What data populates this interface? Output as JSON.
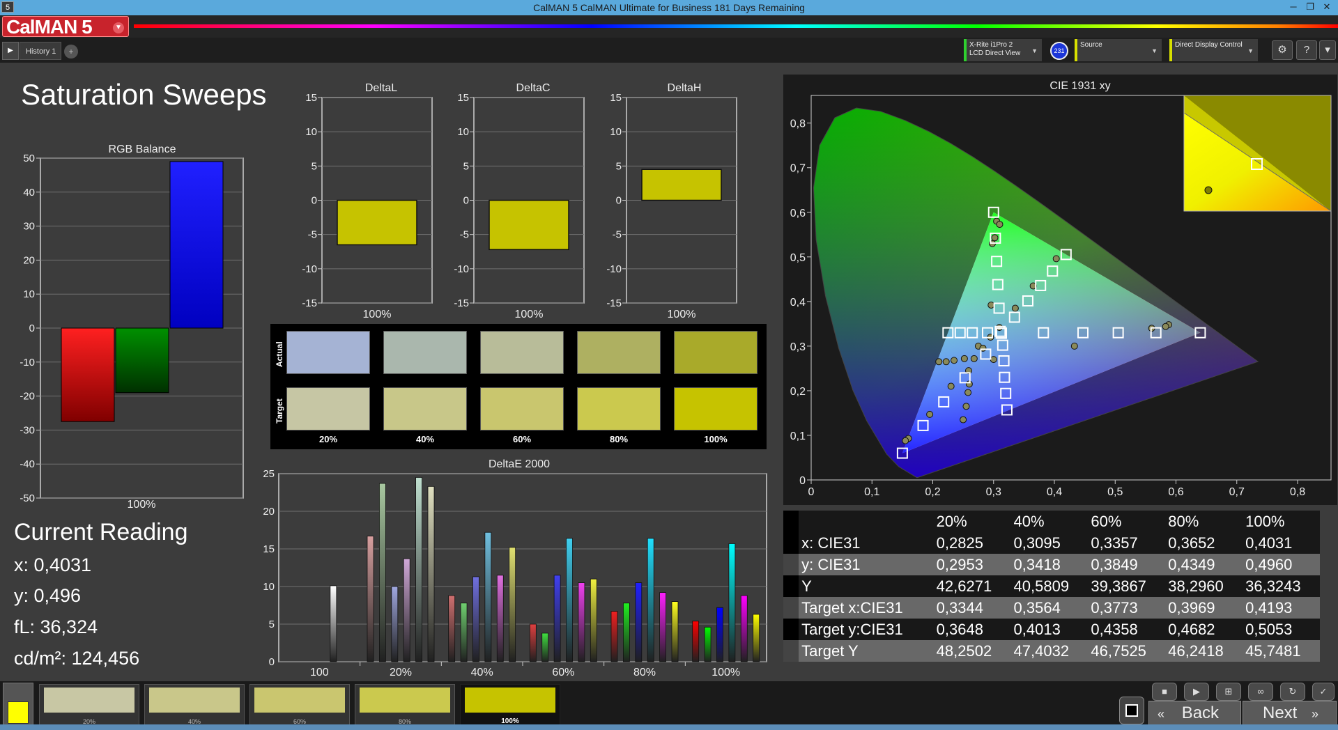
{
  "window": {
    "title": "CalMAN 5 CalMAN Ultimate for Business 181 Days Remaining",
    "app_icon": "5"
  },
  "app": {
    "logo": "CalMAN 5"
  },
  "tabs": [
    {
      "label": "History 1"
    }
  ],
  "devices": {
    "meter_line1": "X-Rite i1Pro 2",
    "meter_line2": "LCD Direct View",
    "meter_badge": "231",
    "source": "Source",
    "display": "Direct Display Control"
  },
  "page": {
    "title": "Saturation Sweeps"
  },
  "rgb_balance": {
    "title": "RGB Balance",
    "yticks": [
      "50",
      "40",
      "30",
      "20",
      "10",
      "0",
      "-10",
      "-20",
      "-30",
      "-40",
      "-50"
    ],
    "xlabel": "100%"
  },
  "delta_charts": [
    {
      "title": "DeltaL",
      "xlabel": "100%"
    },
    {
      "title": "DeltaC",
      "xlabel": "100%"
    },
    {
      "title": "DeltaH",
      "xlabel": "100%"
    }
  ],
  "delta_yticks": [
    "15",
    "10",
    "5",
    "0",
    "-5",
    "-10",
    "-15"
  ],
  "swatches": {
    "row_actual": "Actual",
    "row_target": "Target",
    "labels": [
      "20%",
      "40%",
      "60%",
      "80%",
      "100%"
    ],
    "actual": [
      "#a5b3d4",
      "#aab7ad",
      "#b8bc99",
      "#aeb061",
      "#a9aa2a"
    ],
    "target": [
      "#c6c6a4",
      "#c8c789",
      "#c9c66e",
      "#cbc94e",
      "#c6c300"
    ]
  },
  "deltae": {
    "title": "DeltaE 2000",
    "yticks": [
      "25",
      "20",
      "15",
      "10",
      "5",
      "0"
    ],
    "xlabels": [
      "100",
      "20%",
      "40%",
      "60%",
      "80%",
      "100%"
    ]
  },
  "cie": {
    "title": "CIE 1931 xy",
    "xticks": [
      "0",
      "0,1",
      "0,2",
      "0,3",
      "0,4",
      "0,5",
      "0,6",
      "0,7",
      "0,8"
    ],
    "yticks": [
      "0,8",
      "0,7",
      "0,6",
      "0,5",
      "0,4",
      "0,3",
      "0,2",
      "0,1",
      "0"
    ]
  },
  "current_reading": {
    "title": "Current Reading",
    "x": "x: 0,4031",
    "y": "y: 0,496",
    "fl": "fL: 36,324",
    "cdm": "cd/m²: 124,456"
  },
  "table": {
    "headers": [
      "",
      "20%",
      "40%",
      "60%",
      "80%",
      "100%"
    ],
    "rows": [
      {
        "label": "x: CIE31",
        "values": [
          "0,2825",
          "0,3095",
          "0,3357",
          "0,3652",
          "0,4031"
        ]
      },
      {
        "label": "y: CIE31",
        "values": [
          "0,2953",
          "0,3418",
          "0,3849",
          "0,4349",
          "0,4960"
        ]
      },
      {
        "label": "Y",
        "values": [
          "42,6271",
          "40,5809",
          "39,3867",
          "38,2960",
          "36,3243"
        ]
      },
      {
        "label": "Target x:CIE31",
        "values": [
          "0,3344",
          "0,3564",
          "0,3773",
          "0,3969",
          "0,4193"
        ]
      },
      {
        "label": "Target y:CIE31",
        "values": [
          "0,3648",
          "0,4013",
          "0,4358",
          "0,4682",
          "0,5053"
        ]
      },
      {
        "label": "Target Y",
        "values": [
          "48,2502",
          "47,4032",
          "46,7525",
          "46,2418",
          "45,7481"
        ]
      }
    ]
  },
  "bottom": {
    "swatch_labels": [
      "20%",
      "40%",
      "60%",
      "80%",
      "100%"
    ],
    "swatch_colors": [
      "#c8c7a4",
      "#c9c78a",
      "#cac66f",
      "#cbc94e",
      "#c6c300"
    ],
    "back": "Back",
    "next": "Next"
  },
  "chart_data": [
    {
      "type": "bar",
      "title": "RGB Balance",
      "categories": [
        "100%"
      ],
      "series": [
        {
          "values": [
            -27.5
          ]
        },
        {
          "values": [
            -19
          ]
        },
        {
          "values": [
            49
          ]
        }
      ],
      "ylim": [
        -50,
        50
      ],
      "colors": [
        "#ff0000",
        "#00a000",
        "#0000ff"
      ]
    },
    {
      "type": "bar",
      "title": "DeltaL",
      "categories": [
        "100%"
      ],
      "values": [
        -6.5
      ],
      "ylim": [
        -15,
        15
      ]
    },
    {
      "type": "bar",
      "title": "DeltaC",
      "categories": [
        "100%"
      ],
      "values": [
        -7.2
      ],
      "ylim": [
        -15,
        15
      ]
    },
    {
      "type": "bar",
      "title": "DeltaH",
      "categories": [
        "100%"
      ],
      "values": [
        4.5
      ],
      "ylim": [
        -15,
        15
      ]
    },
    {
      "type": "bar",
      "title": "DeltaE 2000",
      "categories": [
        "100",
        "20%",
        "40%",
        "60%",
        "80%",
        "100%"
      ],
      "ylim": [
        0,
        25
      ],
      "groups": [
        {
          "values": [
            10.1
          ],
          "colors": [
            "#ffffff"
          ]
        },
        {
          "values": [
            16.7,
            23.7,
            10.0,
            13.7,
            24.5,
            23.3
          ],
          "colors": [
            "#d8a0a0",
            "#a8c8a0",
            "#a0a8e0",
            "#d0a8d8",
            "#c0e0d0",
            "#e0e0c0"
          ]
        },
        {
          "values": [
            8.8,
            7.8,
            11.3,
            17.2,
            11.5,
            15.2
          ],
          "colors": [
            "#d07070",
            "#70d070",
            "#7070e0",
            "#70c0e0",
            "#e070e0",
            "#e0e070"
          ]
        },
        {
          "values": [
            5.0,
            3.8,
            11.5,
            16.4,
            10.5,
            11.0
          ],
          "colors": [
            "#e04040",
            "#40e040",
            "#4040f0",
            "#40d0f0",
            "#f040f0",
            "#f0f040"
          ]
        },
        {
          "values": [
            6.7,
            7.8,
            10.5,
            16.4,
            9.2,
            8.0
          ],
          "colors": [
            "#f02020",
            "#20f020",
            "#2020ff",
            "#20e0ff",
            "#ff20ff",
            "#ffff20"
          ]
        },
        {
          "values": [
            5.4,
            4.6,
            7.2,
            15.7,
            8.8,
            6.3
          ],
          "colors": [
            "#ff0000",
            "#00ff00",
            "#0000ff",
            "#00ffff",
            "#ff00ff",
            "#ffff00"
          ]
        }
      ]
    },
    {
      "type": "scatter",
      "title": "CIE 1931 xy",
      "xlim": [
        0,
        0.8
      ],
      "ylim": [
        0,
        0.8
      ],
      "gamut": [
        [
          0.64,
          0.33
        ],
        [
          0.3,
          0.6
        ],
        [
          0.15,
          0.06
        ]
      ],
      "targets": [
        [
          0.15,
          0.06
        ],
        [
          0.184,
          0.122
        ],
        [
          0.218,
          0.175
        ],
        [
          0.253,
          0.229
        ],
        [
          0.287,
          0.282
        ],
        [
          0.3127,
          0.329
        ],
        [
          0.3,
          0.6
        ],
        [
          0.303,
          0.542
        ],
        [
          0.305,
          0.49
        ],
        [
          0.307,
          0.438
        ],
        [
          0.309,
          0.385
        ],
        [
          0.311,
          0.333
        ],
        [
          0.64,
          0.33
        ],
        [
          0.567,
          0.33
        ],
        [
          0.505,
          0.33
        ],
        [
          0.447,
          0.33
        ],
        [
          0.382,
          0.33
        ],
        [
          0.3127,
          0.329
        ],
        [
          0.3127,
          0.329
        ],
        [
          0.322,
          0.157
        ],
        [
          0.32,
          0.194
        ],
        [
          0.318,
          0.23
        ],
        [
          0.317,
          0.267
        ],
        [
          0.315,
          0.302
        ],
        [
          0.3127,
          0.329
        ],
        [
          0.225,
          0.33
        ],
        [
          0.245,
          0.33
        ],
        [
          0.265,
          0.33
        ],
        [
          0.29,
          0.33
        ],
        [
          0.3127,
          0.329
        ],
        [
          0.3344,
          0.3648
        ],
        [
          0.3564,
          0.4013
        ],
        [
          0.3773,
          0.4358
        ],
        [
          0.3969,
          0.4682
        ],
        [
          0.4193,
          0.5053
        ]
      ],
      "actual": [
        [
          0.16,
          0.093
        ],
        [
          0.155,
          0.088
        ],
        [
          0.195,
          0.147
        ],
        [
          0.23,
          0.21
        ],
        [
          0.259,
          0.245
        ],
        [
          0.295,
          0.32
        ],
        [
          0.305,
          0.58
        ],
        [
          0.302,
          0.543
        ],
        [
          0.296,
          0.392
        ],
        [
          0.588,
          0.348
        ],
        [
          0.583,
          0.344
        ],
        [
          0.56,
          0.34
        ],
        [
          0.433,
          0.3
        ],
        [
          0.25,
          0.135
        ],
        [
          0.255,
          0.165
        ],
        [
          0.258,
          0.196
        ],
        [
          0.26,
          0.215
        ],
        [
          0.3,
          0.27
        ],
        [
          0.21,
          0.265
        ],
        [
          0.222,
          0.265
        ],
        [
          0.235,
          0.268
        ],
        [
          0.252,
          0.272
        ],
        [
          0.268,
          0.272
        ],
        [
          0.275,
          0.3
        ],
        [
          0.2825,
          0.2953
        ],
        [
          0.3095,
          0.3418
        ],
        [
          0.3357,
          0.3849
        ],
        [
          0.3652,
          0.4349
        ],
        [
          0.4031,
          0.496
        ],
        [
          0.31,
          0.573
        ],
        [
          0.298,
          0.53
        ]
      ]
    }
  ]
}
